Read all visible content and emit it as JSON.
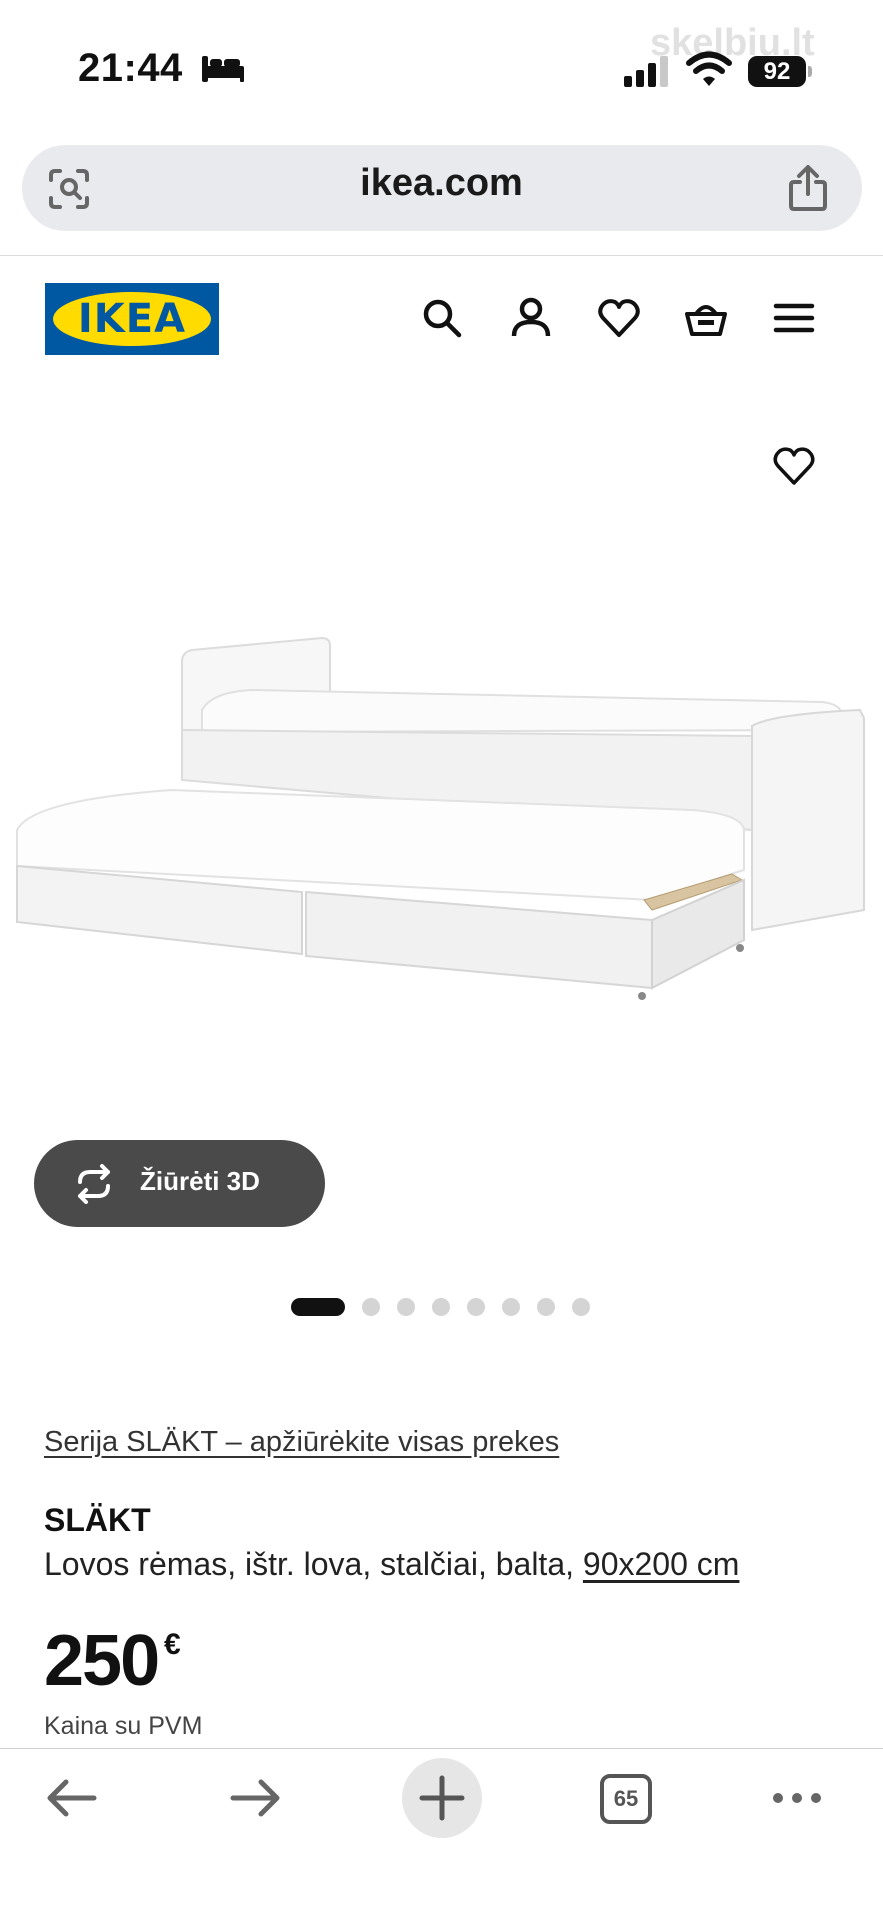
{
  "status_bar": {
    "time": "21:44",
    "battery": "92",
    "watermark": "skelbiu.lt"
  },
  "browser": {
    "url": "ikea.com",
    "tabs_count": "65"
  },
  "header": {
    "logo_text": "IKEA",
    "icons": [
      "search-icon",
      "account-icon",
      "heart-icon",
      "basket-icon",
      "menu-icon"
    ]
  },
  "product": {
    "view_3d_label": "Žiūrėti 3D",
    "gallery_count": 8,
    "gallery_active_index": 0,
    "series_link": "Serija SLÄKT – apžiūrėkite visas prekes",
    "name": "SLÄKT",
    "description": "Lovos rėmas, ištr. lova, stalčiai, balta, ",
    "size": "90x200 cm",
    "price": "250",
    "currency": "€",
    "vat_note": "Kaina su PVM"
  },
  "colors": {
    "ikea_blue": "#0058a3",
    "ikea_yellow": "#ffdb00",
    "view3d_bg": "#4a4a4a"
  }
}
